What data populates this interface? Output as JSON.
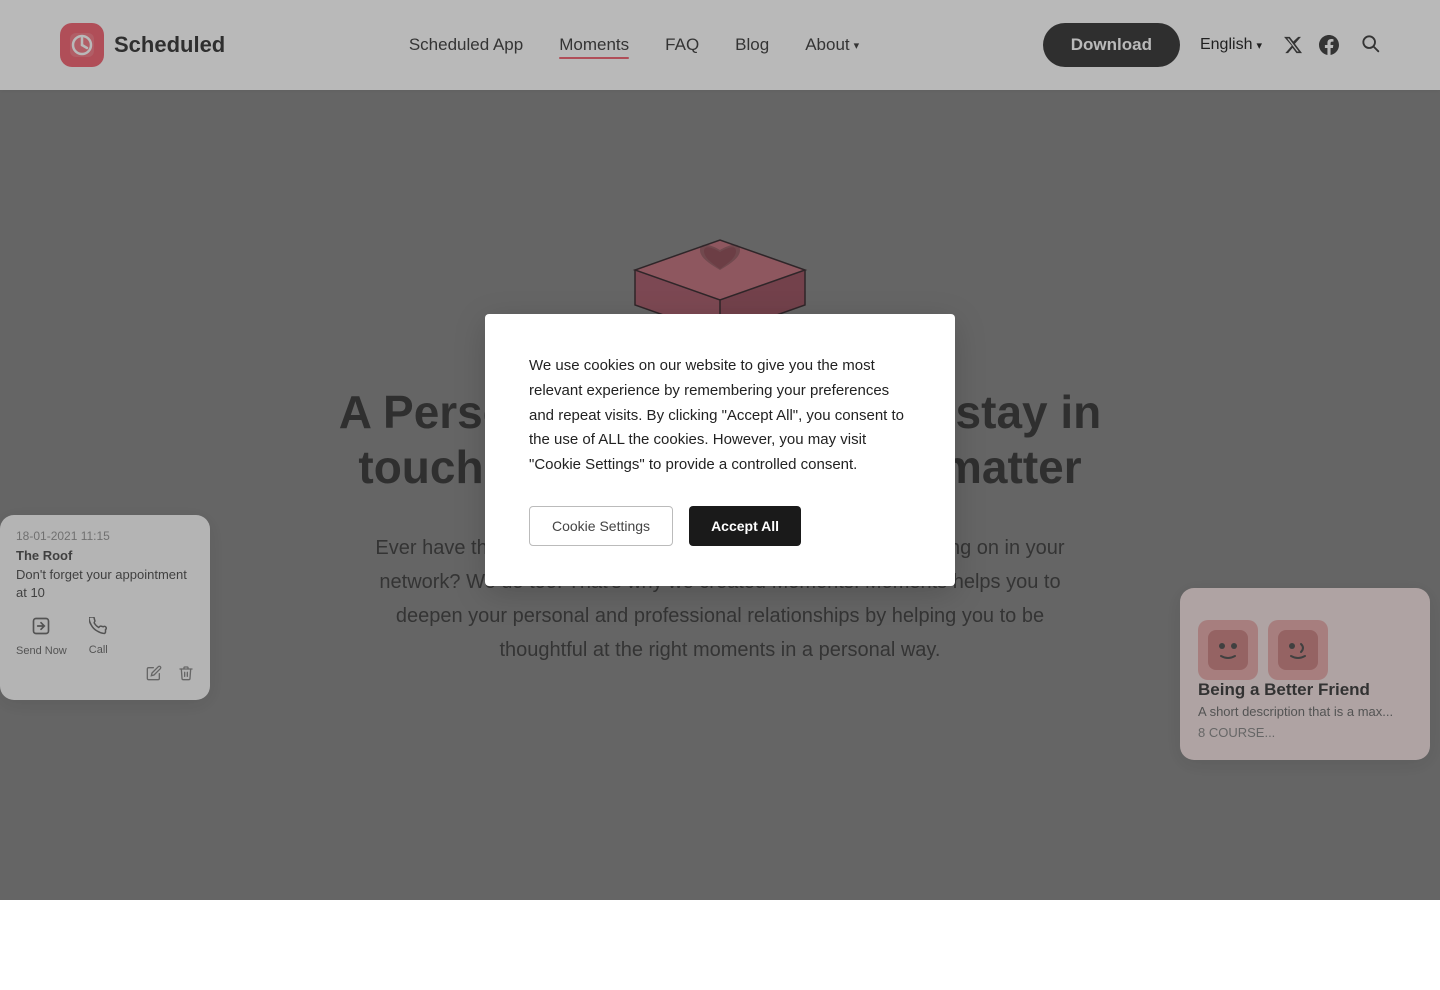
{
  "navbar": {
    "logo_text": "Scheduled",
    "links": [
      {
        "label": "Scheduled App",
        "active": false,
        "id": "scheduled-app"
      },
      {
        "label": "Moments",
        "active": true,
        "id": "moments"
      },
      {
        "label": "FAQ",
        "active": false,
        "id": "faq"
      },
      {
        "label": "Blog",
        "active": false,
        "id": "blog"
      },
      {
        "label": "About",
        "active": false,
        "id": "about",
        "dropdown": true
      },
      {
        "label": "English",
        "active": false,
        "id": "english",
        "dropdown": true
      }
    ],
    "download_label": "Download"
  },
  "hero": {
    "title": "A Personal app helping you stay in touch with the people that matter",
    "body": "Ever have the feeling you can't keep up with everything that's going on in your network? We do too! That's why we created Moments. Moments helps you to deepen your personal and professional relationships by helping you to be thoughtful at the right moments in a personal way."
  },
  "cookie_modal": {
    "text": "We use cookies on our website to give you the most relevant experience by remembering your preferences and repeat visits. By clicking \"Accept All\", you consent to the use of ALL the cookies. However, you may visit \"Cookie Settings\" to provide a controlled consent.",
    "settings_label": "Cookie Settings",
    "accept_label": "Accept All"
  },
  "left_card": {
    "date": "18-01-2021 11:15",
    "location": "The Roof",
    "message": "Don't forget your appointment at 10",
    "send_now_label": "Send Now",
    "call_label": "Call"
  },
  "right_card": {
    "title": "Being a Better Friend",
    "subtitle": "A short description that is a max...",
    "count": "8 COURSE..."
  },
  "icons": {
    "search": "🔍",
    "twitter": "𝕏",
    "facebook": "f",
    "send": "📤",
    "phone": "📞",
    "pencil": "✏️",
    "trash": "🗑️",
    "chevron_down": "▾",
    "choc_heart": "❤️"
  },
  "colors": {
    "brand_red": "#f04e5e",
    "nav_bg": "#ffffff",
    "hero_overlay": "rgba(110,110,110,0.5)",
    "download_bg": "#1a1a1a",
    "cookie_accept_bg": "#1a1a1a"
  }
}
